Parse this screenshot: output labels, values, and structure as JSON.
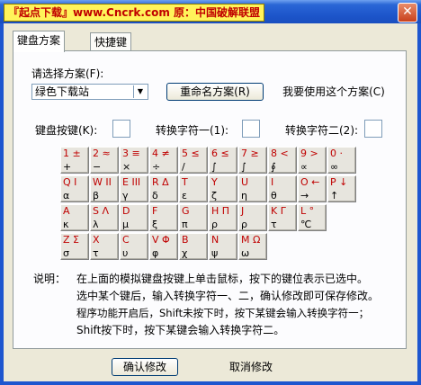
{
  "window": {
    "title": "『起点下载』www.Cncrk.com 原：中国破解联盟",
    "close_glyph": "✕"
  },
  "tabs": [
    {
      "label": "键盘方案",
      "active": true
    },
    {
      "label": "快捷键",
      "active": false
    }
  ],
  "scheme": {
    "label": "请选择方案(F):",
    "selected": "绿色下载站",
    "rename_button": "重命名方案(R)",
    "use_button": "我要使用这个方案(C)"
  },
  "fields": {
    "key_label": "键盘按键(K):",
    "char1_label": "转换字符一(1):",
    "char2_label": "转换字符二(2):"
  },
  "keyboard": {
    "rows": [
      [
        {
          "top": "1 ±",
          "bottom": "+"
        },
        {
          "top": "2 ≈",
          "bottom": "−"
        },
        {
          "top": "3 ≡",
          "bottom": "×"
        },
        {
          "top": "4 ≠",
          "bottom": "÷"
        },
        {
          "top": "5 ≤",
          "bottom": "/"
        },
        {
          "top": "6 ≤",
          "bottom": "∫"
        },
        {
          "top": "7 ≥",
          "bottom": "∫"
        },
        {
          "top": "8 <",
          "bottom": "∮"
        },
        {
          "top": "9 >",
          "bottom": "∝"
        },
        {
          "top": "0 ·",
          "bottom": "∞"
        }
      ],
      [
        {
          "top": "Q I",
          "bottom": "α"
        },
        {
          "top": "W II",
          "bottom": "β"
        },
        {
          "top": "E III",
          "bottom": "γ"
        },
        {
          "top": "R Δ",
          "bottom": "δ"
        },
        {
          "top": "T",
          "bottom": "ε"
        },
        {
          "top": "Y",
          "bottom": "ζ"
        },
        {
          "top": "U",
          "bottom": "η"
        },
        {
          "top": "I",
          "bottom": "θ"
        },
        {
          "top": "O ←",
          "bottom": "→"
        },
        {
          "top": "P ↓",
          "bottom": "↑"
        }
      ],
      [
        {
          "top": "A",
          "bottom": "κ"
        },
        {
          "top": "S Λ",
          "bottom": "λ"
        },
        {
          "top": "D",
          "bottom": "μ"
        },
        {
          "top": "F",
          "bottom": "ξ"
        },
        {
          "top": "G",
          "bottom": "π"
        },
        {
          "top": "H Π",
          "bottom": "ρ"
        },
        {
          "top": "J",
          "bottom": "ρ"
        },
        {
          "top": "K Γ",
          "bottom": "τ"
        },
        {
          "top": "L °",
          "bottom": "℃"
        }
      ],
      [
        {
          "top": "Z Σ",
          "bottom": "σ"
        },
        {
          "top": "X",
          "bottom": "τ"
        },
        {
          "top": "C",
          "bottom": "υ"
        },
        {
          "top": "V Φ",
          "bottom": "φ"
        },
        {
          "top": "B",
          "bottom": "χ"
        },
        {
          "top": "N",
          "bottom": "ψ"
        },
        {
          "top": "M Ω",
          "bottom": "ω"
        }
      ]
    ]
  },
  "note": {
    "label": "说明：",
    "lines": [
      "在上面的模拟键盘按键上单击鼠标，按下的键位表示已选中。",
      "选中某个键后，输入转换字符一、二，确认修改即可保存修改。",
      "程序功能开启后，Shift未按下时，按下某键会输入转换字符一；",
      "Shift按下时，按下某键会输入转换字符二。"
    ]
  },
  "footer": {
    "confirm": "确认修改",
    "cancel": "取消修改"
  },
  "colors": {
    "key_top_text": "#c00000",
    "titlebar": "#1c54c9",
    "dialog_bg": "#ece9d8"
  }
}
